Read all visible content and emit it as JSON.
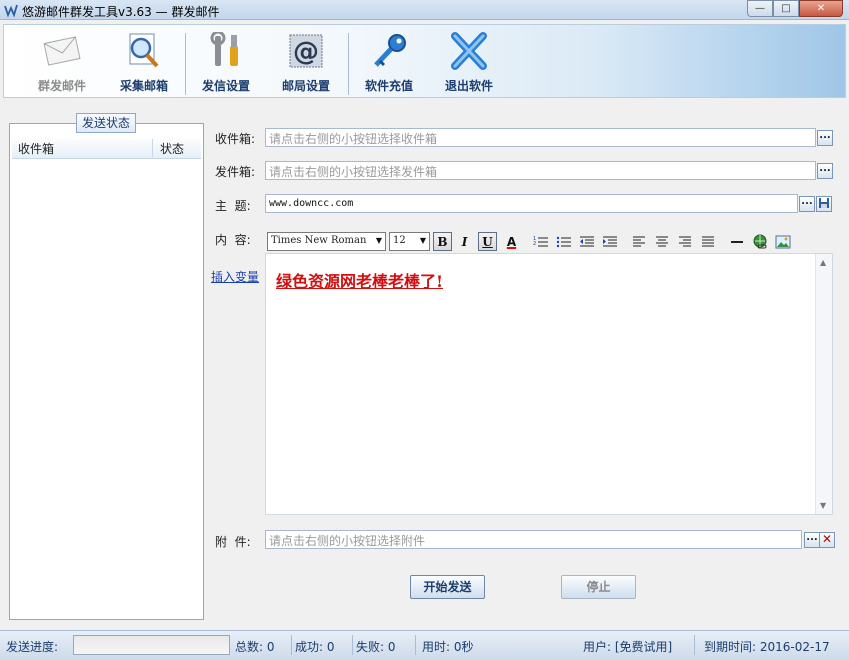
{
  "window": {
    "title": "悠游邮件群发工具v3.63 — 群发邮件",
    "min_glyph": "—",
    "max_glyph": "□",
    "close_glyph": "✕"
  },
  "toolbar": {
    "items": [
      {
        "label": "群发邮件",
        "icon": "envelope-icon",
        "enabled": false
      },
      {
        "label": "采集邮箱",
        "icon": "magnifier-icon",
        "enabled": true
      },
      {
        "label": "发信设置",
        "icon": "tools-icon",
        "enabled": true
      },
      {
        "label": "邮局设置",
        "icon": "at-sign-icon",
        "enabled": true
      },
      {
        "label": "软件充值",
        "icon": "key-icon",
        "enabled": true
      },
      {
        "label": "退出软件",
        "icon": "exit-x-icon",
        "enabled": true
      }
    ]
  },
  "left_panel": {
    "title": "发送状态",
    "columns": [
      "收件箱",
      "状态"
    ]
  },
  "form": {
    "inbox_label": "收件箱:",
    "inbox_placeholder": "请点击右侧的小按钮选择收件箱",
    "sender_label": "发件箱:",
    "sender_placeholder": "请点击右侧的小按钮选择发件箱",
    "subject_label": "主  题:",
    "subject_value": "www.downcc.com",
    "content_label": "内  容:",
    "insert_variable": "插入变量",
    "attachment_label": "附  件:",
    "attachment_placeholder": "请点击右侧的小按钮选择附件",
    "browse_glyph": "...",
    "clear_glyph": "✕"
  },
  "editor_toolbar": {
    "font_name": "Times New Roman",
    "font_size": "12",
    "bold": "B",
    "italic": "I",
    "underline": "U",
    "font_color": "A"
  },
  "editor": {
    "content": "绿色资源网老棒老棒了!"
  },
  "buttons": {
    "start": "开始发送",
    "stop": "停止"
  },
  "status": {
    "progress_label": "发送进度:",
    "progress": 0,
    "total": "总数: 0",
    "success": "成功: 0",
    "failed": "失败: 0",
    "elapsed": "用时: 0秒",
    "user": "用户: [免费试用]",
    "expiry": "到期时间: 2016-02-17"
  },
  "colors": {
    "accent": "#1c3d6e",
    "content_text": "#d01010",
    "link": "#1a3fb0"
  }
}
